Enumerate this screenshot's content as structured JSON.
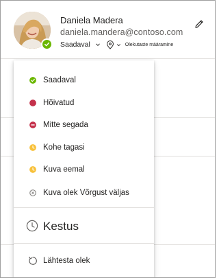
{
  "profile": {
    "name": "Daniela Madera",
    "email": "daniela.mandera@contoso.com",
    "status_label": "Saadaval",
    "location_label": "Olekutaste määramine",
    "presence_color": "#6bb700"
  },
  "menu": {
    "items": [
      {
        "label": "Saadaval",
        "icon": "available-icon",
        "color": "#6bb700"
      },
      {
        "label": "Hõivatud",
        "icon": "busy-icon",
        "color": "#c4314b"
      },
      {
        "label": "Mitte segada",
        "icon": "do-not-disturb-icon",
        "color": "#c4314b"
      },
      {
        "label": "Kohe tagasi",
        "icon": "be-right-back-icon",
        "color": "#f8c13b"
      },
      {
        "label": "Kuva eemal",
        "icon": "away-icon",
        "color": "#f8c13b"
      },
      {
        "label": "Kuva olek Võrgust väljas",
        "icon": "offline-icon",
        "color": "#8a8886"
      }
    ],
    "duration_label": "Kestus",
    "reset_label": "Lähtesta olek"
  }
}
